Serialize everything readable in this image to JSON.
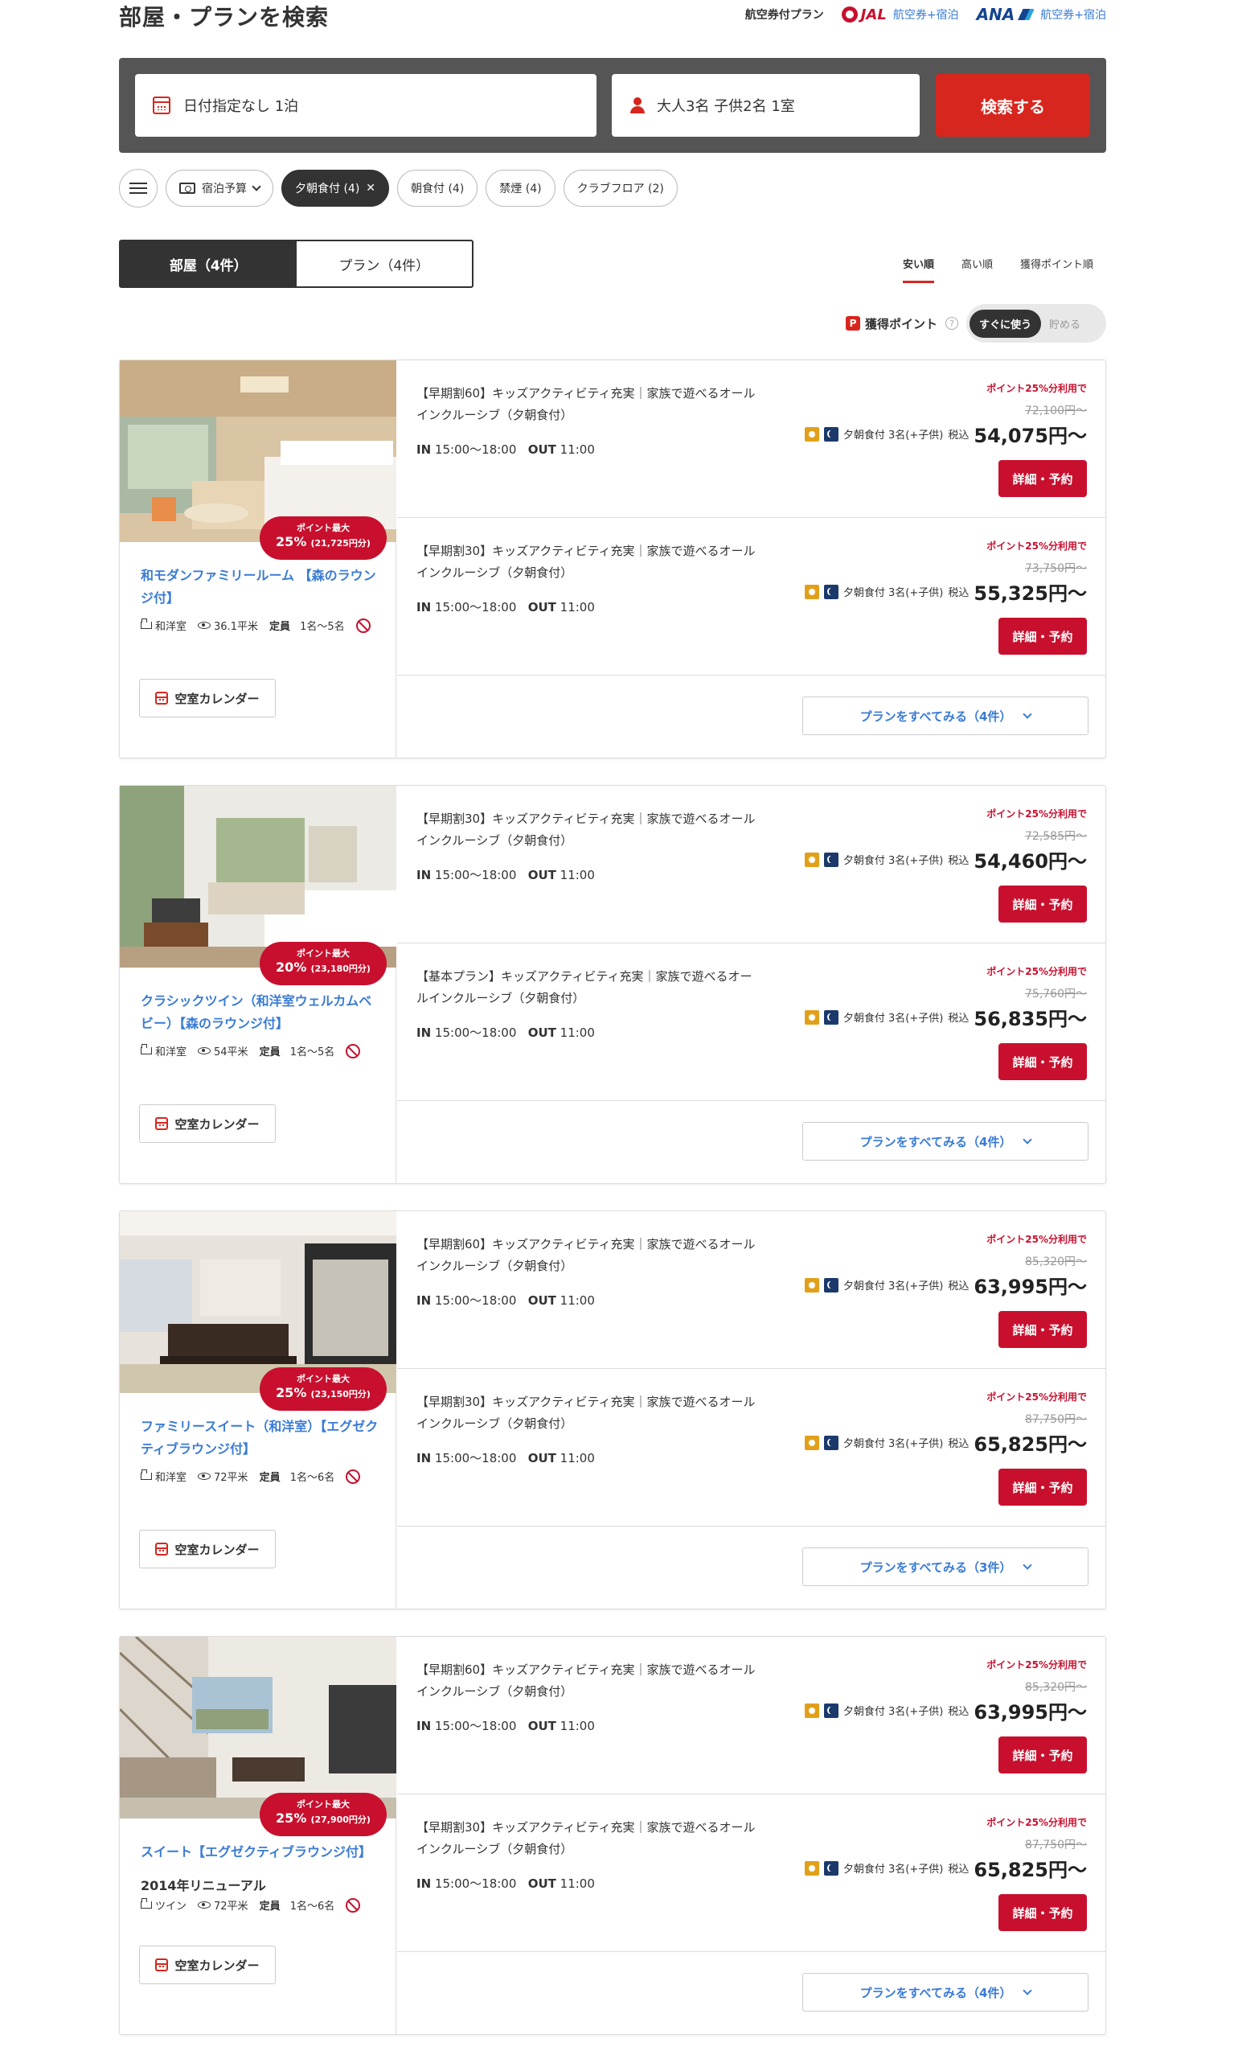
{
  "header": {
    "title": "部屋・プランを検索",
    "air_plan_label": "航空券付プラン",
    "jal_logo": "JAL",
    "jal_link": "航空券+宿泊",
    "ana_logo": "ANA",
    "ana_link": "航空券+宿泊"
  },
  "search": {
    "date_value": "日付指定なし 1泊",
    "guest_value": "大人3名 子供2名 1室",
    "search_button": "検索する"
  },
  "filters": {
    "budget": "宿泊予算",
    "chips": [
      {
        "label": "夕朝食付 (4)",
        "active": true
      },
      {
        "label": "朝食付 (4)",
        "active": false
      },
      {
        "label": "禁煙 (4)",
        "active": false
      },
      {
        "label": "クラブフロア (2)",
        "active": false
      }
    ]
  },
  "tabs": {
    "rooms": "部屋（4件）",
    "plans": "プラン（4件）"
  },
  "sort": {
    "cheap": "安い順",
    "expensive": "高い順",
    "points": "獲得ポイント順"
  },
  "points": {
    "label": "獲得ポイント",
    "help": "?",
    "use_now": "すぐに使う",
    "save": "貯める"
  },
  "common": {
    "checkin_label": "IN",
    "checkin_time": "15:00〜18:00",
    "checkout_label": "OUT",
    "checkout_time": "11:00",
    "points_note": "ポイント25%分利用で",
    "meal_text": "夕朝食付 3名(+子供)",
    "tax": "税込",
    "book_button": "詳細・予約",
    "calendar_button": "空室カレンダー",
    "badge_top": "ポイント最大",
    "bed_type_jy": "和洋室",
    "bed_type_twin": "ツイン",
    "capacity_label": "定員"
  },
  "rooms": [
    {
      "name": "和モダンファミリールーム 【森のラウンジ付】",
      "subtitle": "",
      "badge_pct": "25%",
      "badge_amt": "(21,725円分)",
      "bed": "和洋室",
      "area": "36.1平米",
      "capacity": "1名〜5名",
      "more": "プランをすべてみる（4件）",
      "plans": [
        {
          "title": "【早期割60】キッズアクティビティ充実｜家族で遊べるオールインクルーシブ（夕朝食付）",
          "orig": "72,100円〜",
          "price": "54,075円〜"
        },
        {
          "title": "【早期割30】キッズアクティビティ充実｜家族で遊べるオールインクルーシブ（夕朝食付）",
          "orig": "73,750円〜",
          "price": "55,325円〜"
        }
      ]
    },
    {
      "name": "クラシックツイン（和洋室ウェルカムベビー）【森のラウンジ付】",
      "subtitle": "",
      "badge_pct": "20%",
      "badge_amt": "(23,180円分)",
      "bed": "和洋室",
      "area": "54平米",
      "capacity": "1名〜5名",
      "more": "プランをすべてみる（4件）",
      "plans": [
        {
          "title": "【早期割30】キッズアクティビティ充実｜家族で遊べるオールインクルーシブ（夕朝食付）",
          "orig": "72,585円〜",
          "price": "54,460円〜"
        },
        {
          "title": "【基本プラン】キッズアクティビティ充実｜家族で遊べるオールインクルーシブ（夕朝食付）",
          "orig": "75,760円〜",
          "price": "56,835円〜"
        }
      ]
    },
    {
      "name": "ファミリースイート（和洋室）【エグゼクティブラウンジ付】",
      "subtitle": "",
      "badge_pct": "25%",
      "badge_amt": "(23,150円分)",
      "bed": "和洋室",
      "area": "72平米",
      "capacity": "1名〜6名",
      "more": "プランをすべてみる（3件）",
      "plans": [
        {
          "title": "【早期割60】キッズアクティビティ充実｜家族で遊べるオールインクルーシブ（夕朝食付）",
          "orig": "85,320円〜",
          "price": "63,995円〜"
        },
        {
          "title": "【早期割30】キッズアクティビティ充実｜家族で遊べるオールインクルーシブ（夕朝食付）",
          "orig": "87,750円〜",
          "price": "65,825円〜"
        }
      ]
    },
    {
      "name": "スイート【エグゼクティブラウンジ付】",
      "subtitle": "2014年リニューアル",
      "badge_pct": "25%",
      "badge_amt": "(27,900円分)",
      "bed": "ツイン",
      "area": "72平米",
      "capacity": "1名〜6名",
      "more": "プランをすべてみる（4件）",
      "plans": [
        {
          "title": "【早期割60】キッズアクティビティ充実｜家族で遊べるオールインクルーシブ（夕朝食付）",
          "orig": "85,320円〜",
          "price": "63,995円〜"
        },
        {
          "title": "【早期割30】キッズアクティビティ充実｜家族で遊べるオールインクルーシブ（夕朝食付）",
          "orig": "87,750円〜",
          "price": "65,825円〜"
        }
      ]
    }
  ]
}
